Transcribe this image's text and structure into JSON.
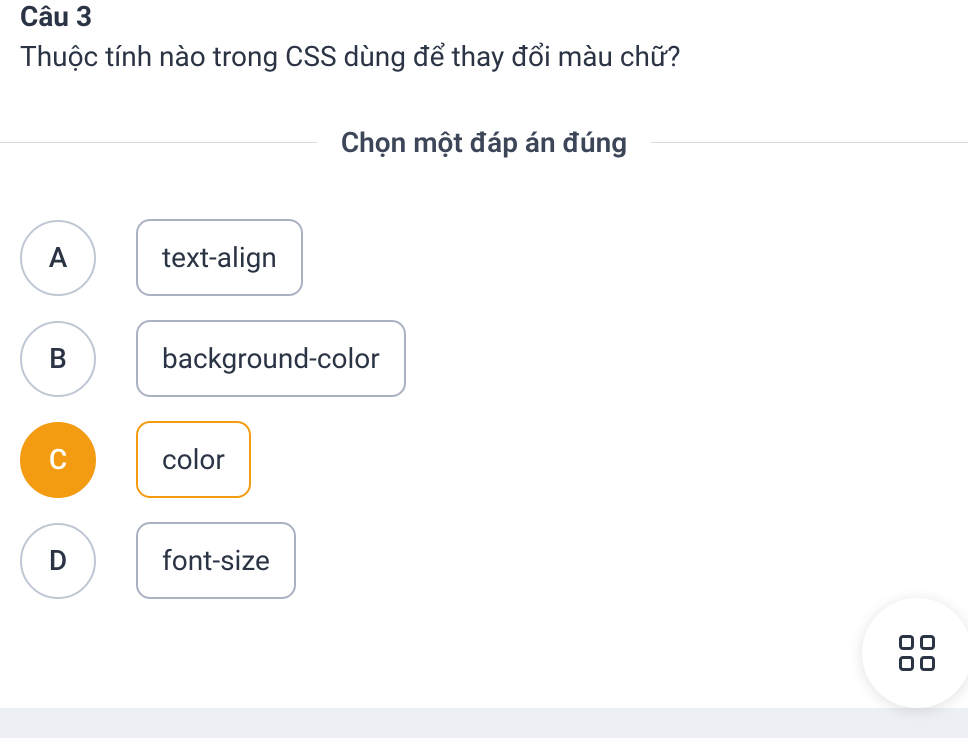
{
  "question": {
    "number": "Câu 3",
    "text": "Thuộc tính nào trong CSS dùng để thay đổi màu chữ?"
  },
  "instruction": "Chọn một đáp án đúng",
  "options": [
    {
      "letter": "A",
      "text": "text-align",
      "selected": false
    },
    {
      "letter": "B",
      "text": "background-color",
      "selected": false
    },
    {
      "letter": "C",
      "text": "color",
      "selected": true
    },
    {
      "letter": "D",
      "text": "font-size",
      "selected": false
    }
  ]
}
